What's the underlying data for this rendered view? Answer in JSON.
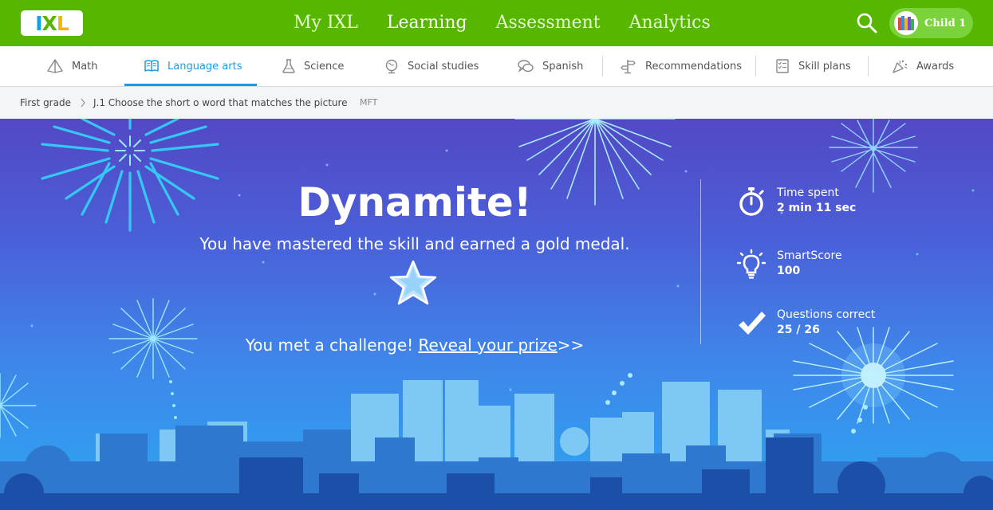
{
  "header": {
    "logo": {
      "i": "I",
      "x": "X",
      "l": "L"
    },
    "nav": [
      {
        "label": "My IXL",
        "active": false
      },
      {
        "label": "Learning",
        "active": true
      },
      {
        "label": "Assessment",
        "active": false
      },
      {
        "label": "Analytics",
        "active": false
      }
    ],
    "search_icon": "magnifier-icon",
    "user": {
      "name": "Child 1",
      "avatar_icon": "books-avatar-icon"
    }
  },
  "subjects": [
    {
      "label": "Math",
      "icon": "pyramid-icon"
    },
    {
      "label": "Language arts",
      "icon": "book-icon",
      "active": true
    },
    {
      "label": "Science",
      "icon": "flask-icon"
    },
    {
      "label": "Social studies",
      "icon": "globe-icon"
    },
    {
      "label": "Spanish",
      "icon": "speech-bubbles-icon"
    },
    {
      "label": "Recommendations",
      "icon": "signpost-icon"
    },
    {
      "label": "Skill plans",
      "icon": "checklist-icon"
    },
    {
      "label": "Awards",
      "icon": "confetti-icon"
    }
  ],
  "breadcrumb": {
    "grade": "First grade",
    "skill": "J.1 Choose the short o word that matches the picture",
    "code": "MFT"
  },
  "celebration": {
    "headline": "Dynamite!",
    "message": "You have mastered the skill and earned a gold medal.",
    "challenge_text": "You met a challenge!",
    "reveal_link": "Reveal your prize",
    "reveal_suffix": ">>"
  },
  "stats": [
    {
      "label": "Time spent",
      "value": "2 min 11 sec",
      "icon": "stopwatch-icon"
    },
    {
      "label": "SmartScore",
      "value": "100",
      "icon": "lightbulb-icon"
    },
    {
      "label": "Questions correct",
      "value": "25 / 26",
      "icon": "checkmark-icon"
    }
  ],
  "colors": {
    "brand_green": "#56b600",
    "accent_blue": "#1a9de0",
    "sky_top": "#5348c4",
    "sky_bottom": "#2ba7f1"
  }
}
